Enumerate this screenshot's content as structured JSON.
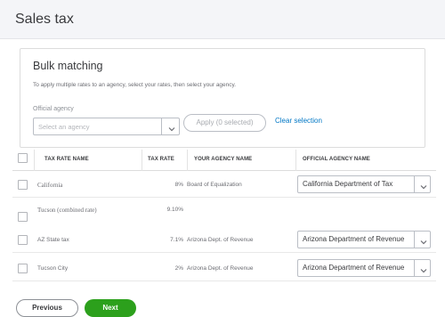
{
  "header": {
    "title": "Sales tax"
  },
  "bulk": {
    "title": "Bulk matching",
    "description": "To apply multiple rates to an agency, select your rates, then select your agency.",
    "agency_label": "Official agency",
    "agency_placeholder": "Select an agency",
    "apply_label": "Apply (0 selected)",
    "clear_label": "Clear selection"
  },
  "table": {
    "columns": [
      "TAX RATE NAME",
      "TAX RATE",
      "YOUR AGENCY NAME",
      "OFFICIAL AGENCY NAME"
    ],
    "rows": [
      {
        "name": "California",
        "rate": "8%",
        "agency": "Board of Equalization",
        "official": "California Department of Tax"
      },
      {
        "name": "Tucson (combined rate)",
        "rate": "9.10%",
        "agency": "",
        "official": ""
      },
      {
        "name": "AZ State tax",
        "rate": "7.1%",
        "agency": "Arizona Dept. of Revenue",
        "official": "Arizona Department of Revenue"
      },
      {
        "name": "Tucson City",
        "rate": "2%",
        "agency": "Arizona Dept. of Revenue",
        "official": "Arizona Department of Revenue"
      }
    ]
  },
  "footer": {
    "previous_label": "Previous",
    "next_label": "Next"
  },
  "colors": {
    "accent_green": "#2ca01c",
    "link_blue": "#0077c5"
  }
}
